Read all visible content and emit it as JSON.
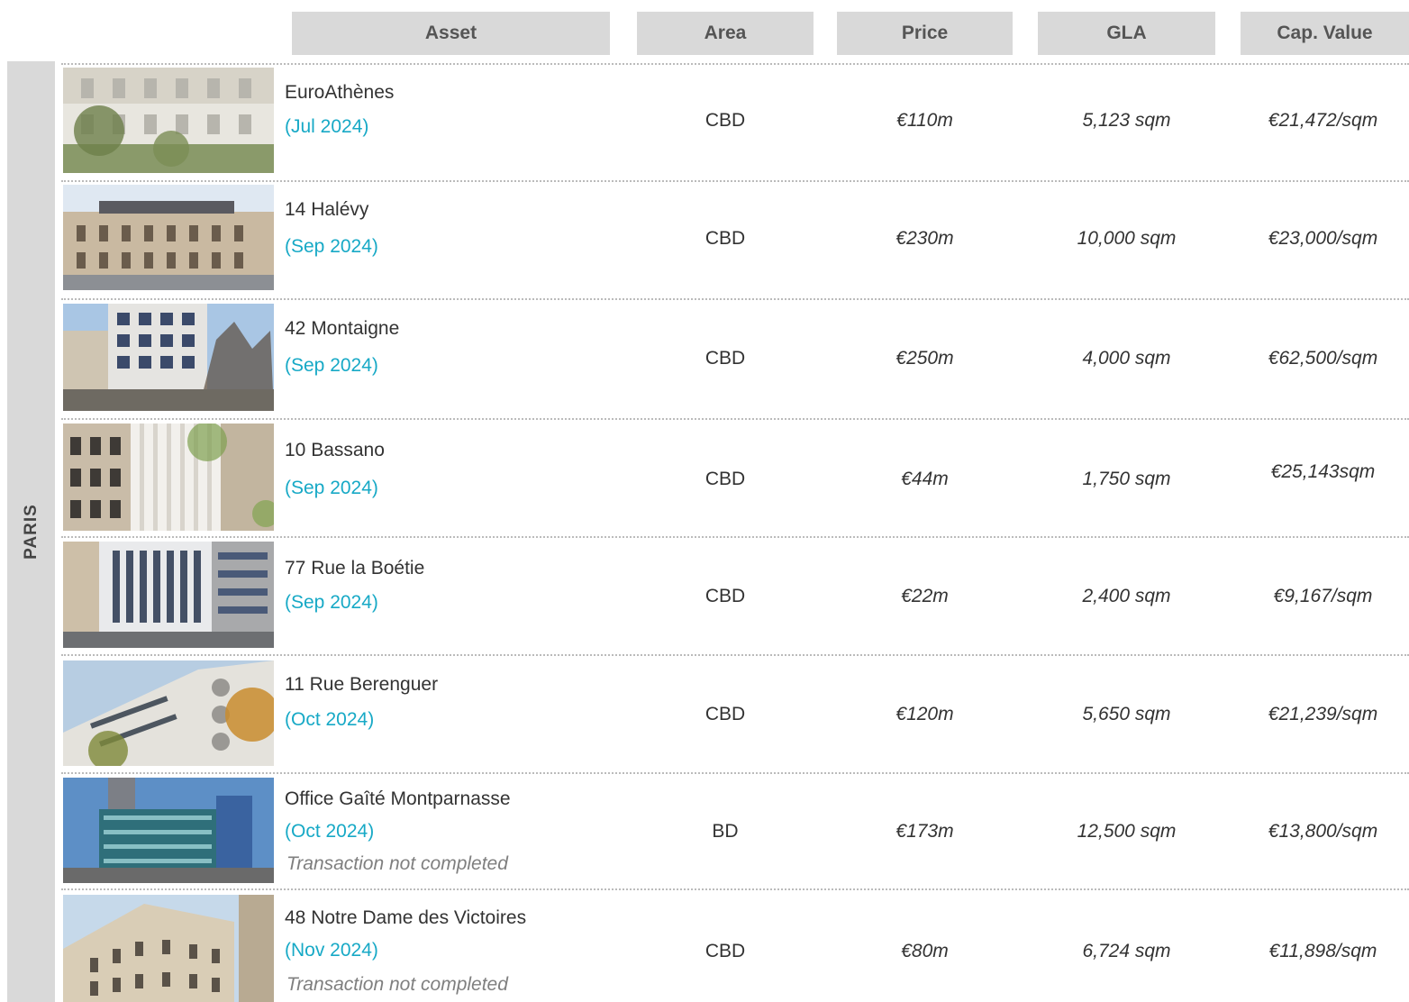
{
  "headers": {
    "asset": "Asset",
    "area": "Area",
    "price": "Price",
    "gla": "GLA",
    "cap_value": "Cap. Value"
  },
  "region": "PARIS",
  "rows": [
    {
      "name": "EuroAthènes",
      "date": "(Jul 2024)",
      "note": "",
      "area": "CBD",
      "price": "€110m",
      "gla": "5,123 sqm",
      "cap_value": "€21,472/sqm",
      "photo": "building-photo"
    },
    {
      "name": "14 Halévy",
      "date": "(Sep 2024)",
      "note": "",
      "area": "CBD",
      "price": "€230m",
      "gla": "10,000 sqm",
      "cap_value": "€23,000/sqm",
      "photo": "building-photo"
    },
    {
      "name": "42 Montaigne",
      "date": "(Sep 2024)",
      "note": "",
      "area": "CBD",
      "price": "€250m",
      "gla": "4,000 sqm",
      "cap_value": "€62,500/sqm",
      "photo": "building-photo"
    },
    {
      "name": "10 Bassano",
      "date": "(Sep 2024)",
      "note": "",
      "area": "CBD",
      "price": "€44m",
      "gla": "1,750 sqm",
      "cap_value": "€25,143sqm",
      "photo": "building-photo"
    },
    {
      "name": "77 Rue la Boétie",
      "date": "(Sep 2024)",
      "note": "",
      "area": "CBD",
      "price": "€22m",
      "gla": "2,400 sqm",
      "cap_value": "€9,167/sqm",
      "photo": "building-photo"
    },
    {
      "name": "11 Rue Berenguer",
      "date": "(Oct 2024)",
      "note": "",
      "area": "CBD",
      "price": "€120m",
      "gla": "5,650 sqm",
      "cap_value": "€21,239/sqm",
      "photo": "building-photo"
    },
    {
      "name": "Office Gaîté Montparnasse",
      "date": "(Oct 2024)",
      "note": "Transaction not completed",
      "area": "BD",
      "price": "€173m",
      "gla": "12,500 sqm",
      "cap_value": "€13,800/sqm",
      "photo": "building-photo"
    },
    {
      "name": "48 Notre Dame des Victoires",
      "date": "(Nov 2024)",
      "note": "Transaction not completed",
      "area": "CBD",
      "price": "€80m",
      "gla": "6,724 sqm",
      "cap_value": "€11,898/sqm",
      "photo": "building-photo"
    }
  ],
  "colors": {
    "header_bg": "#d9d9d9",
    "date_accent": "#17a9c6",
    "note_grey": "#7f7f7f"
  }
}
